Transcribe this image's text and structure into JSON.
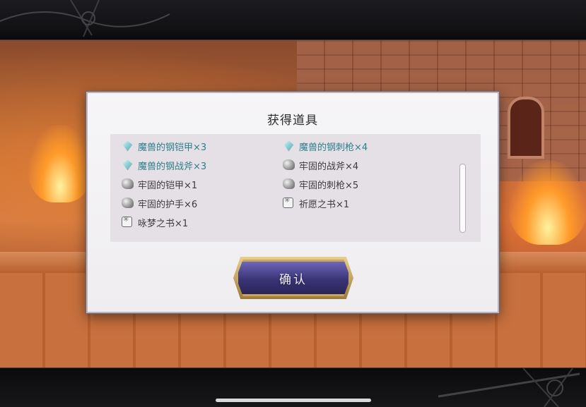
{
  "dialog": {
    "title": "获得道具",
    "confirm_label": "确认",
    "items": [
      {
        "name": "魔兽的钢铠甲×3",
        "icon": "gem-icon",
        "rarity": "rare"
      },
      {
        "name": "魔兽的钢刺枪×4",
        "icon": "gem-icon",
        "rarity": "rare"
      },
      {
        "name": "魔兽的钢战斧×3",
        "icon": "gem-icon",
        "rarity": "rare"
      },
      {
        "name": "牢固的战斧×4",
        "icon": "ore-icon",
        "rarity": "common"
      },
      {
        "name": "牢固的铠甲×1",
        "icon": "ore-icon",
        "rarity": "common"
      },
      {
        "name": "牢固的刺枪×5",
        "icon": "ore-icon",
        "rarity": "common"
      },
      {
        "name": "牢固的护手×6",
        "icon": "ore-icon",
        "rarity": "common"
      },
      {
        "name": "祈愿之书×1",
        "icon": "book-icon",
        "rarity": "common"
      },
      {
        "name": "咏梦之书×1",
        "icon": "book-icon",
        "rarity": "common"
      }
    ]
  },
  "colors": {
    "rare_text": "#2f7f8a",
    "common_text": "#3b3b3e",
    "button_gold": "#c8a760",
    "button_purple": "#3a3476"
  }
}
